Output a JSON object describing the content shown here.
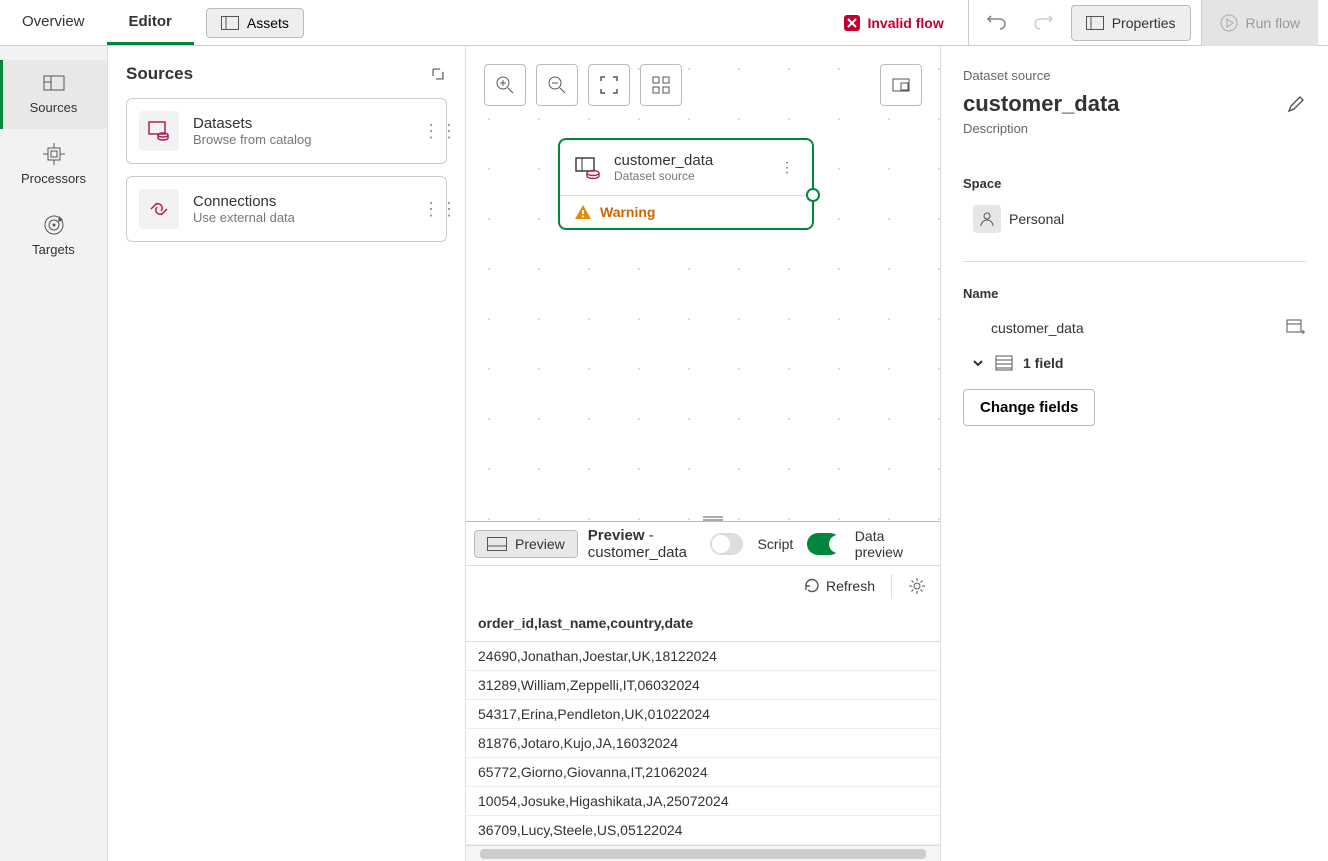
{
  "topbar": {
    "tabs": [
      {
        "label": "Overview"
      },
      {
        "label": "Editor",
        "active": true
      }
    ],
    "assets_label": "Assets",
    "invalid_flow_label": "Invalid flow",
    "properties_label": "Properties",
    "run_label": "Run flow"
  },
  "left_rail": [
    {
      "label": "Sources",
      "active": true
    },
    {
      "label": "Processors"
    },
    {
      "label": "Targets"
    }
  ],
  "sources_panel": {
    "title": "Sources",
    "cards": [
      {
        "title": "Datasets",
        "sub": "Browse from catalog"
      },
      {
        "title": "Connections",
        "sub": "Use external data"
      }
    ]
  },
  "canvas": {
    "node": {
      "title": "customer_data",
      "subtitle": "Dataset source",
      "warning_label": "Warning"
    }
  },
  "preview": {
    "button_label": "Preview",
    "title_prefix": "Preview ",
    "title_name": "- customer_data",
    "script_label": "Script",
    "data_preview_label": "Data preview",
    "refresh_label": "Refresh",
    "header": "order_id,last_name,country,date",
    "rows": [
      "24690,Jonathan,Joestar,UK,18122024",
      "31289,William,Zeppelli,IT,06032024",
      "54317,Erina,Pendleton,UK,01022024",
      "81876,Jotaro,Kujo,JA,16032024",
      "65772,Giorno,Giovanna,IT,21062024",
      "10054,Josuke,Higashikata,JA,25072024",
      "36709,Lucy,Steele,US,05122024"
    ]
  },
  "props": {
    "kicker": "Dataset source",
    "title": "customer_data",
    "description_label": "Description",
    "space_label": "Space",
    "space_value": "Personal",
    "name_label": "Name",
    "name_value": "customer_data",
    "field_count_label": "1 field",
    "change_fields_label": "Change fields"
  }
}
